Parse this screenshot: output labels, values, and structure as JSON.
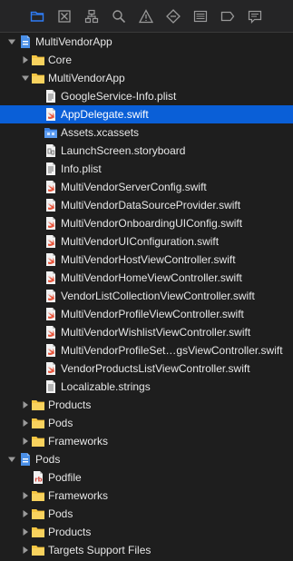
{
  "toolbar": {
    "icons": [
      "folder-icon",
      "source-control-icon",
      "hierarchy-icon",
      "search-icon",
      "issue-icon",
      "test-icon",
      "debug-icon",
      "breakpoint-icon",
      "report-icon"
    ]
  },
  "colors": {
    "selection": "#0a5fd7",
    "active_icon": "#2f7df6",
    "folder": "#f5c542",
    "swift": "#e8543a"
  },
  "tree": [
    {
      "label": "MultiVendorApp",
      "type": "project",
      "expanded": true
    },
    {
      "label": "Core",
      "type": "folder",
      "expanded": false
    },
    {
      "label": "MultiVendorApp",
      "type": "folder",
      "expanded": true
    },
    {
      "label": "GoogleService-Info.plist",
      "type": "plist"
    },
    {
      "label": "AppDelegate.swift",
      "type": "swift",
      "selected": true
    },
    {
      "label": "Assets.xcassets",
      "type": "assets"
    },
    {
      "label": "LaunchScreen.storyboard",
      "type": "storyboard"
    },
    {
      "label": "Info.plist",
      "type": "plist"
    },
    {
      "label": "MultiVendorServerConfig.swift",
      "type": "swift"
    },
    {
      "label": "MultiVendorDataSourceProvider.swift",
      "type": "swift"
    },
    {
      "label": "MultiVendorOnboardingUIConfig.swift",
      "type": "swift"
    },
    {
      "label": "MultiVendorUIConfiguration.swift",
      "type": "swift"
    },
    {
      "label": "MultiVendorHostViewController.swift",
      "type": "swift"
    },
    {
      "label": "MultiVendorHomeViewController.swift",
      "type": "swift"
    },
    {
      "label": "VendorListCollectionViewController.swift",
      "type": "swift"
    },
    {
      "label": "MultiVendorProfileViewController.swift",
      "type": "swift"
    },
    {
      "label": "MultiVendorWishlistViewController.swift",
      "type": "swift"
    },
    {
      "label": "MultiVendorProfileSet…gsViewController.swift",
      "type": "swift"
    },
    {
      "label": "VendorProductsListViewController.swift",
      "type": "swift"
    },
    {
      "label": "Localizable.strings",
      "type": "strings"
    },
    {
      "label": "Products",
      "type": "folder",
      "expanded": false
    },
    {
      "label": "Pods",
      "type": "folder",
      "expanded": false
    },
    {
      "label": "Frameworks",
      "type": "folder",
      "expanded": false
    },
    {
      "label": "Pods",
      "type": "project",
      "expanded": true
    },
    {
      "label": "Podfile",
      "type": "podfile"
    },
    {
      "label": "Frameworks",
      "type": "folder",
      "expanded": false
    },
    {
      "label": "Pods",
      "type": "folder",
      "expanded": false
    },
    {
      "label": "Products",
      "type": "folder",
      "expanded": false
    },
    {
      "label": "Targets Support Files",
      "type": "folder",
      "expanded": false
    }
  ]
}
